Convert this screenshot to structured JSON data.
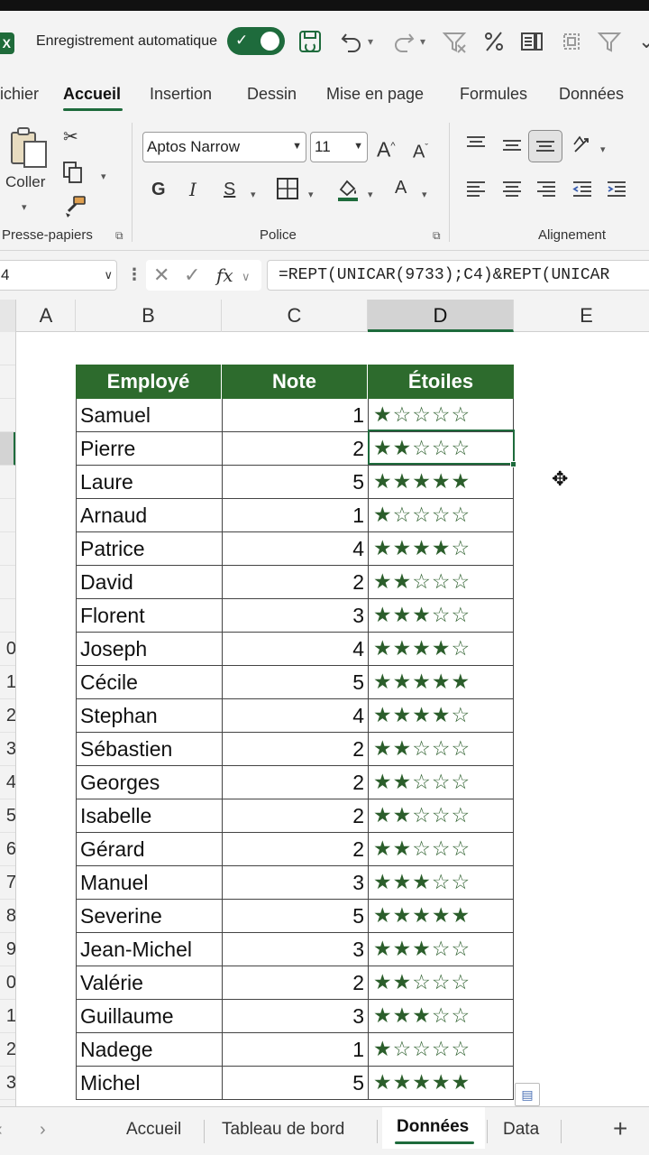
{
  "quick_access": {
    "app_logo": "X",
    "autosave_label": "Enregistrement automatique",
    "autosave_check": "✓",
    "icons": [
      "save-icon",
      "undo-icon",
      "redo-icon",
      "clear-filter-icon",
      "percent-icon",
      "form-icon",
      "select-icon",
      "filter-settings-icon",
      "more-icon"
    ]
  },
  "ribbon_tabs": [
    "ichier",
    "Accueil",
    "Insertion",
    "Dessin",
    "Mise en page",
    "Formules",
    "Données"
  ],
  "ribbon": {
    "clipboard": {
      "paste_label": "Coller",
      "group_label": "Presse-papiers"
    },
    "font": {
      "font_name": "Aptos Narrow",
      "font_size": "11",
      "grow_label": "A",
      "shrink_label": "A",
      "bold_label": "G",
      "italic_label": "I",
      "underline_label": "S",
      "font_color_label": "A",
      "group_label": "Police"
    },
    "alignment": {
      "group_label": "Alignement"
    }
  },
  "formula_bar": {
    "name_box": "4",
    "fx_label": "fx",
    "formula": "=REPT(UNICAR(9733);C4)&REPT(UNICAR"
  },
  "grid": {
    "column_headers": [
      "A",
      "B",
      "C",
      "D",
      "E"
    ],
    "selected_column": "D",
    "row_headers": [
      "",
      "",
      "",
      "",
      "",
      "",
      "",
      "",
      "",
      "0",
      "1",
      "2",
      "3",
      "4",
      "5",
      "6",
      "7",
      "8",
      "9",
      "0",
      "1",
      "2",
      "3"
    ]
  },
  "table": {
    "headers": [
      "Employé",
      "Note",
      "Étoiles"
    ],
    "rows": [
      {
        "name": "Samuel",
        "note": "1",
        "stars": "★☆☆☆☆"
      },
      {
        "name": "Pierre",
        "note": "2",
        "stars": "★★☆☆☆"
      },
      {
        "name": "Laure",
        "note": "5",
        "stars": "★★★★★"
      },
      {
        "name": "Arnaud",
        "note": "1",
        "stars": "★☆☆☆☆"
      },
      {
        "name": "Patrice",
        "note": "4",
        "stars": "★★★★☆"
      },
      {
        "name": "David",
        "note": "2",
        "stars": "★★☆☆☆"
      },
      {
        "name": "Florent",
        "note": "3",
        "stars": "★★★☆☆"
      },
      {
        "name": "Joseph",
        "note": "4",
        "stars": "★★★★☆"
      },
      {
        "name": "Cécile",
        "note": "5",
        "stars": "★★★★★"
      },
      {
        "name": "Stephan",
        "note": "4",
        "stars": "★★★★☆"
      },
      {
        "name": "Sébastien",
        "note": "2",
        "stars": "★★☆☆☆"
      },
      {
        "name": "Georges",
        "note": "2",
        "stars": "★★☆☆☆"
      },
      {
        "name": "Isabelle",
        "note": "2",
        "stars": "★★☆☆☆"
      },
      {
        "name": "Gérard",
        "note": "2",
        "stars": "★★☆☆☆"
      },
      {
        "name": "Manuel",
        "note": "3",
        "stars": "★★★☆☆"
      },
      {
        "name": "Severine",
        "note": "5",
        "stars": "★★★★★"
      },
      {
        "name": "Jean-Michel",
        "note": "3",
        "stars": "★★★☆☆"
      },
      {
        "name": "Valérie",
        "note": "2",
        "stars": "★★☆☆☆"
      },
      {
        "name": "Guillaume",
        "note": "3",
        "stars": "★★★☆☆"
      },
      {
        "name": "Nadege",
        "note": "1",
        "stars": "★☆☆☆☆"
      },
      {
        "name": "Michel",
        "note": "5",
        "stars": "★★★★★"
      }
    ],
    "selected_row_index": 1
  },
  "sheet_tabs": {
    "tabs": [
      "Accueil",
      "Tableau de bord",
      "Données",
      "Data"
    ],
    "active": "Données",
    "add_label": "+"
  },
  "colors": {
    "accent": "#1e6b3c",
    "header_fill": "#2d6b2d",
    "star": "#2b5e2b"
  }
}
